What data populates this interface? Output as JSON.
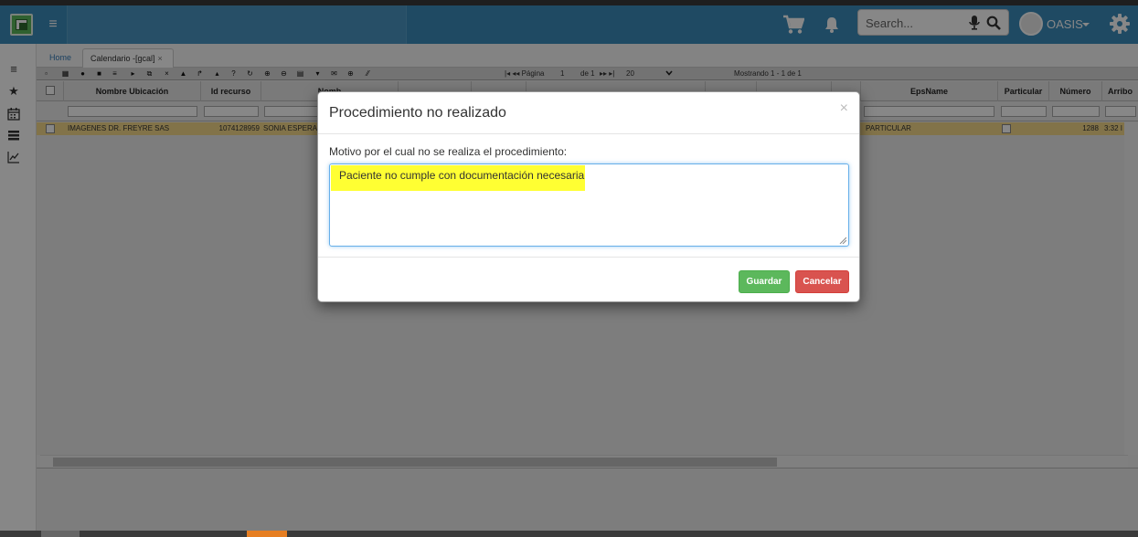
{
  "navbar": {
    "search_placeholder": "Search...",
    "user_name": "OASIS",
    "icons": [
      "cart-icon",
      "bell-icon",
      "mic-icon",
      "search-icon",
      "gear-icon"
    ]
  },
  "tabs": [
    {
      "label": "Home"
    },
    {
      "label": "Calendario -[gcal]",
      "close": "×"
    }
  ],
  "toolbar": {
    "pager_first": "|◂ ◂◂ Página",
    "page": "1",
    "of_label": "de 1",
    "pager_next": "▸▸ ▸|",
    "rows": "20",
    "showing": "Mostrando 1 - 1 de 1"
  },
  "grid": {
    "columns": [
      "Nombre Ubicación",
      "Id recurso",
      "Nomb",
      "EpsName",
      "Particular",
      "Número",
      "Arribo"
    ],
    "row": {
      "ubicacion": "IMAGENES DR. FREYRE SAS",
      "id_recurso": "1074128959",
      "nombre": "SONIA ESPERA",
      "eps": "PARTICULAR",
      "numero": "1288",
      "arribo": "3:32 I"
    }
  },
  "modal": {
    "title": "Procedimiento no realizado",
    "close": "×",
    "label": "Motivo por el cual no se realiza el procedimiento:",
    "textarea_value": "Paciente no cumple con documentación necesaria",
    "save_label": "Guardar",
    "cancel_label": "Cancelar"
  },
  "colors": {
    "navbar": "#3c8dbc",
    "save": "#5cb85c",
    "cancel": "#d9534f",
    "selected_row": "#f5d98a",
    "highlight": "#ffff33"
  }
}
